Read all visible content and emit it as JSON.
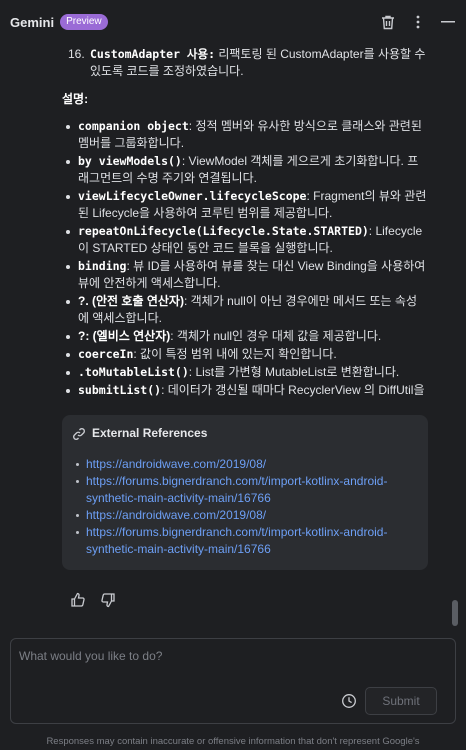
{
  "header": {
    "title": "Gemini",
    "badge": "Preview",
    "icons": [
      "trash-icon",
      "more-vertical-icon",
      "minimize-icon"
    ]
  },
  "message": {
    "numbered_item": {
      "number": "16.",
      "bold": "CustomAdapter 사용:",
      "text": " 리팩토링 된 CustomAdapter를 사용할 수 있도록 코드를 조정하였습니다."
    },
    "section_title": "설명:",
    "bullets": [
      {
        "term": "companion object",
        "text": ": 정적 멤버와 유사한 방식으로 클래스와 관련된 멤버를 그룹화합니다."
      },
      {
        "term": "by viewModels()",
        "text": ": ViewModel 객체를 게으르게 초기화합니다. 프래그먼트의 수명 주기와 연결됩니다."
      },
      {
        "term": "viewLifecycleOwner.lifecycleScope",
        "text": ": Fragment의 뷰와 관련된 Lifecycle을 사용하여 코루틴 범위를 제공합니다."
      },
      {
        "term": "repeatOnLifecycle(Lifecycle.State.STARTED)",
        "text": ": Lifecycle이 STARTED 상태인 동안 코드 블록을 실행합니다."
      },
      {
        "term": "binding",
        "text": ": 뷰 ID를 사용하여 뷰를 찾는 대신 View Binding을 사용하여 뷰에 안전하게 액세스합니다."
      },
      {
        "term": "?. (안전 호출 연산자)",
        "text": ": 객체가 null이 아닌 경우에만 메서드 또는 속성에 액세스합니다."
      },
      {
        "term": "?: (엘비스 연산자)",
        "text": ": 객체가 null인 경우 대체 값을 제공합니다."
      },
      {
        "term": "coerceIn",
        "text": ": 값이 특정 범위 내에 있는지 확인합니다."
      },
      {
        "term": ".toMutableList()",
        "text": ": List를 가변형 MutableList로 변환합니다."
      },
      {
        "term": "submitList()",
        "text": ": 데이터가 갱신될 때마다 RecyclerView 의 DiffUtil을"
      }
    ]
  },
  "references": {
    "title": "External References",
    "links": [
      "https://androidwave.com/2019/08/",
      "https://forums.bignerdranch.com/t/import-kotlinx-android-synthetic-main-activity-main/16766",
      "https://androidwave.com/2019/08/",
      "https://forums.bignerdranch.com/t/import-kotlinx-android-synthetic-main-activity-main/16766"
    ]
  },
  "input": {
    "placeholder": "What would you like to do?",
    "value": "",
    "submit_label": "Submit"
  },
  "disclaimer": "Responses may contain inaccurate or offensive information that don't represent Google's",
  "colors": {
    "background": "#1e1f22",
    "badge": "#9a6bd6",
    "link": "#6d9ff5",
    "card": "#2b2d31"
  }
}
